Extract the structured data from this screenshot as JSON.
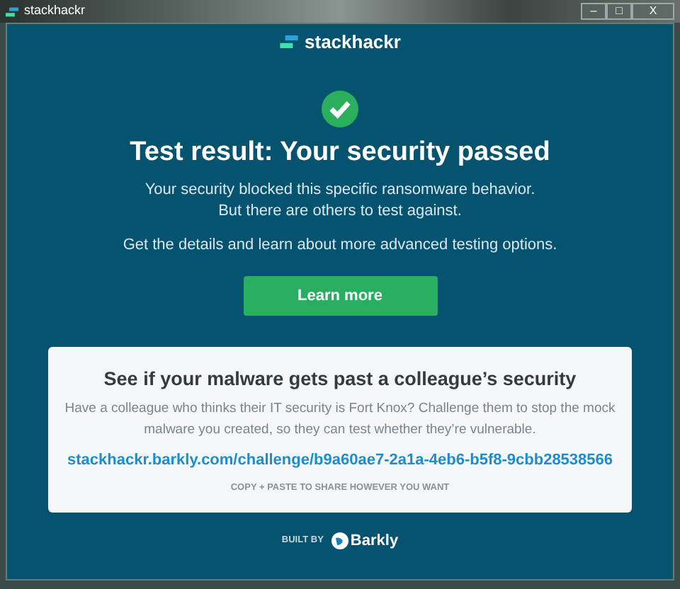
{
  "window": {
    "title": "stackhackr",
    "controls": [
      "–",
      "□",
      "X"
    ]
  },
  "header": {
    "brand": "stackhackr"
  },
  "result": {
    "passed": true,
    "title": "Test result: Your security passed",
    "lines": [
      "Your security blocked this specific ransomware behavior.",
      "But there are others to test against."
    ],
    "details": "Get the details and learn about more advanced testing options.",
    "button": "Learn more"
  },
  "share": {
    "title": "See if your malware gets past a colleague’s security",
    "body": "Have a colleague who thinks their IT security is Fort Knox? Challenge them to stop the mock malware you created, so they can test whether they’re vulnerable.",
    "link": "stackhackr.barkly.com/challenge/b9a60ae7-2a1a-4eb6-b5f8-9cbb28538566",
    "hint": "COPY + PASTE TO SHARE HOWEVER YOU WANT"
  },
  "footer": {
    "built_by": "BUILT BY",
    "company": "Barkly"
  }
}
